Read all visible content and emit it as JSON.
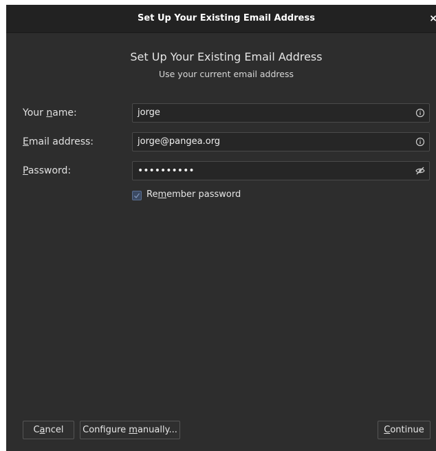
{
  "dialog": {
    "title": "Set Up Your Existing Email Address",
    "close_glyph": "×",
    "heading": "Set Up Your Existing Email Address",
    "subheading": "Use your current email address"
  },
  "fields": {
    "name": {
      "label_pre": "Your ",
      "label_access": "n",
      "label_post": "ame:",
      "value": "jorge",
      "icon": "info-icon"
    },
    "email": {
      "label_pre": "",
      "label_access": "E",
      "label_post": "mail address:",
      "value": "jorge@pangea.org",
      "icon": "info-icon"
    },
    "password": {
      "label_pre": "",
      "label_access": "P",
      "label_post": "assword:",
      "value": "••••••••••",
      "icon": "eye-slash-icon"
    }
  },
  "remember": {
    "checked": true,
    "label_pre": "Re",
    "label_access": "m",
    "label_post": "ember password"
  },
  "buttons": {
    "cancel": {
      "pre": "C",
      "access": "a",
      "post": "ncel"
    },
    "configure": {
      "pre": "Configure ",
      "access": "m",
      "post": "anually..."
    },
    "continue": {
      "pre": "",
      "access": "C",
      "post": "ontinue"
    }
  },
  "colors": {
    "background": "#2d2d2d",
    "titlebar": "#222222",
    "input_bg": "#262626",
    "checkbox_accent": "#5a6f92"
  }
}
